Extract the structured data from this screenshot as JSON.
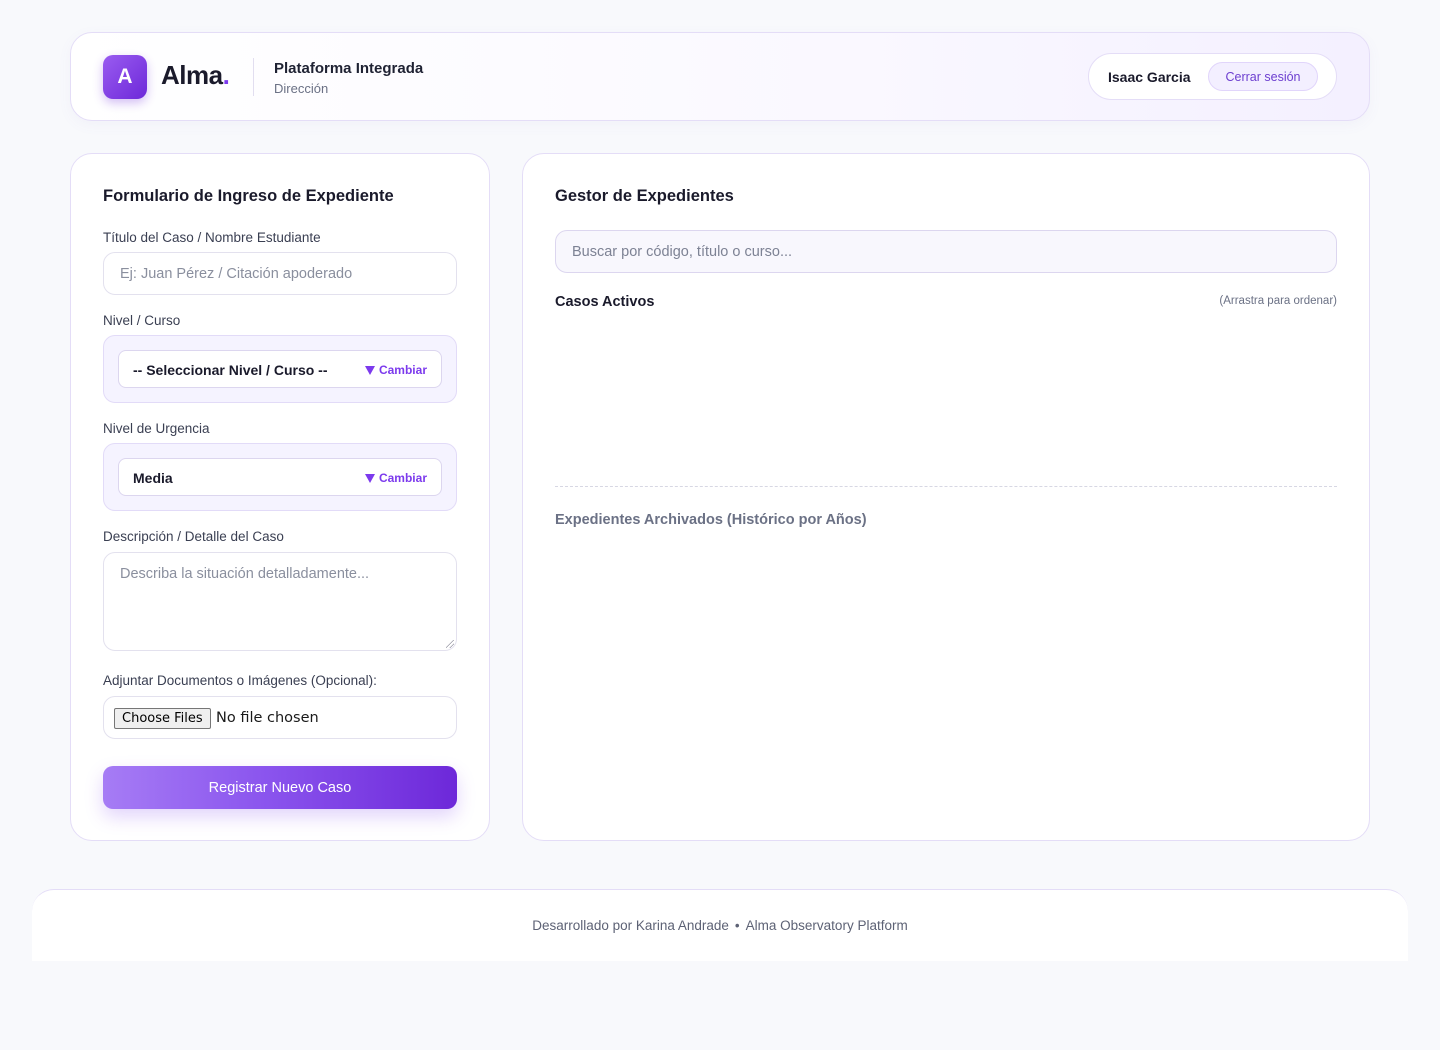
{
  "header": {
    "logo_letter": "A",
    "brand": "Alma",
    "brand_dot": ".",
    "platform_title": "Plataforma Integrada",
    "platform_subtitle": "Dirección",
    "user_name": "Isaac Garcia",
    "logout_label": "Cerrar sesión"
  },
  "form": {
    "title": "Formulario de Ingreso de Expediente",
    "case_title_label": "Título del Caso / Nombre Estudiante",
    "case_title_placeholder": "Ej: Juan Pérez / Citación apoderado",
    "level_label": "Nivel / Curso",
    "level_value": "-- Seleccionar Nivel / Curso --",
    "level_change": "Cambiar",
    "urgency_label": "Nivel de Urgencia",
    "urgency_value": "Media",
    "urgency_change": "Cambiar",
    "description_label": "Descripción / Detalle del Caso",
    "description_placeholder": "Describa la situación detalladamente...",
    "attach_label": "Adjuntar Documentos o Imágenes (Opcional):",
    "choose_files": "Choose Files",
    "no_file": "No file chosen",
    "submit_label": "Registrar Nuevo Caso"
  },
  "manager": {
    "title": "Gestor de Expedientes",
    "search_placeholder": "Buscar por código, título o curso...",
    "active_title": "Casos Activos",
    "drag_hint": "(Arrastra para ordenar)",
    "archived_title": "Expedientes Archivados (Histórico por Años)"
  },
  "footer": {
    "developer": "Desarrollado por Karina Andrade",
    "separator": "•",
    "platform": "Alma Observatory Platform"
  },
  "colors": {
    "accent": "#7c3aed",
    "accent_light": "#f5f3ff",
    "background": "#f8f9fc"
  }
}
